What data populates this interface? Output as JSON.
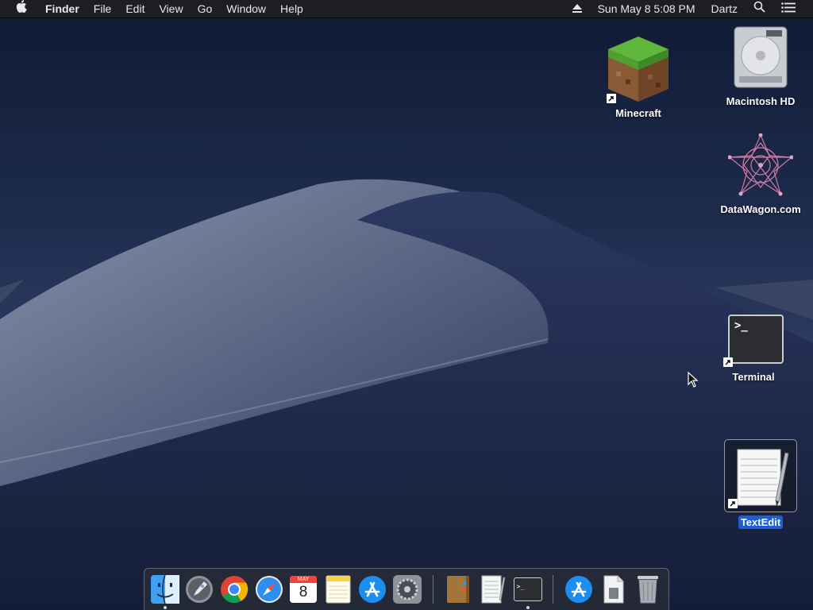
{
  "menubar": {
    "app_name": "Finder",
    "menus": [
      "File",
      "Edit",
      "View",
      "Go",
      "Window",
      "Help"
    ],
    "clock": "Sun May 8  5:08 PM",
    "user": "Dartz",
    "icons": [
      "apple-logo-icon",
      "eject-icon",
      "spotlight-search-icon",
      "notification-center-icon"
    ]
  },
  "desktop": {
    "icons": [
      {
        "label": "Minecraft",
        "icon": "minecraft-grass-block-icon",
        "alias": true
      },
      {
        "label": "Macintosh HD",
        "icon": "hard-drive-icon",
        "alias": false
      },
      {
        "label": "DataWagon.com",
        "icon": "datawagon-star-icon",
        "alias": false
      },
      {
        "label": "Terminal",
        "icon": "terminal-icon",
        "alias": true,
        "prompt": ">_"
      },
      {
        "label": "TextEdit",
        "icon": "textedit-icon",
        "alias": true,
        "selected": true
      }
    ]
  },
  "dock": {
    "calendar_month": "MAY",
    "calendar_day": "8",
    "terminal_prompt": ">_",
    "items": [
      "finder-icon",
      "launchpad-icon",
      "chrome-icon",
      "safari-icon",
      "calendar-icon",
      "notes-icon",
      "app-store-icon",
      "system-preferences-icon",
      "notebook-icon",
      "textedit-icon",
      "terminal-icon",
      "app-store-downloads-icon",
      "document-icon",
      "trash-icon"
    ]
  },
  "colors": {
    "menubar_bg": "#1e1e22",
    "selection": "#1d5fd0",
    "dock_bg": "#282c38"
  }
}
